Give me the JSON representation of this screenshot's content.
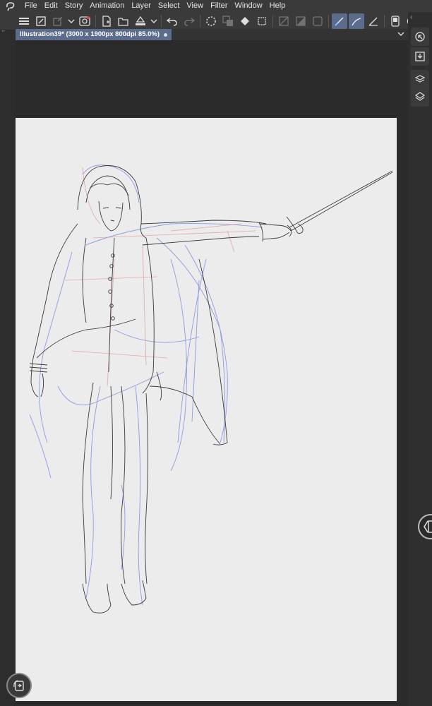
{
  "menu": {
    "items": [
      "File",
      "Edit",
      "Story",
      "Animation",
      "Layer",
      "Select",
      "View",
      "Filter",
      "Window",
      "Help"
    ]
  },
  "toolbar": {
    "icons": [
      "menu-icon",
      "new-canvas-icon",
      "export-icon",
      "chevron-down-icon",
      "record-icon",
      "new-file-icon",
      "open-folder-icon",
      "save-icon",
      "chevron-down-icon",
      "undo-icon",
      "redo-icon",
      "loading-icon",
      "transform-icon",
      "fill-icon",
      "selection-icon",
      "clear-icon",
      "layer-fill-icon",
      "frame-icon",
      "pen-correct-icon",
      "pen-stabilize-icon",
      "pen-vector-icon",
      "phone-icon",
      "help-icon"
    ]
  },
  "document_tab": {
    "title": "Illustration39* (3000 x 1900px 800dpi 85.0%)"
  },
  "colors": {
    "accent": "#5b6c8c",
    "background": "#2b2b2b",
    "paper": "#ececec",
    "sketch_blue": "#6f7fd8",
    "sketch_red": "#e08a8a",
    "line_art": "#3a3a3a"
  },
  "right_panel": {
    "icons": [
      "navigator-icon",
      "import-icon",
      "material-icon",
      "layers-icon"
    ]
  }
}
